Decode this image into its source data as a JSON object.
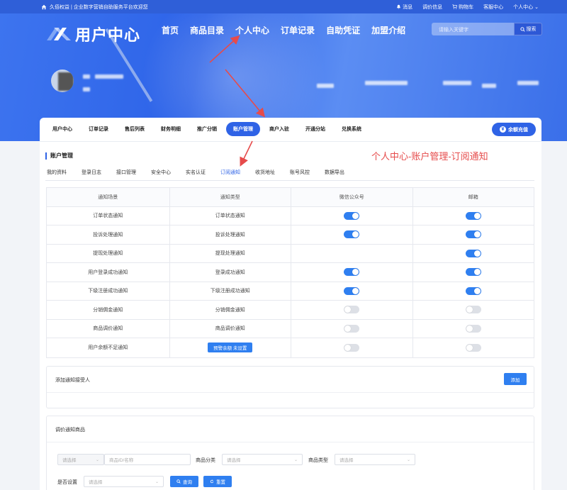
{
  "topbar": {
    "brand_text": "久佰权益 | 企业数字营销自助服务平台欢迎您",
    "links": [
      "消息",
      "调价信息",
      "购物车",
      "客服中心",
      "个人中心"
    ]
  },
  "header": {
    "logo_text": "用户中心",
    "nav": [
      "首页",
      "商品目录",
      "个人中心",
      "订单记录",
      "自助凭证",
      "加盟介绍"
    ],
    "search_placeholder": "请输入关键字",
    "search_button": "搜索"
  },
  "account_tabs": [
    "用户中心",
    "订单记录",
    "售后列表",
    "财务明细",
    "推广分销",
    "账户管理",
    "商户入驻",
    "开通分站",
    "兑换系统"
  ],
  "active_account_tab": "账户管理",
  "recharge_button": "余额充值",
  "section_title": "账户管理",
  "annotation": "个人中心-账户管理-订阅通知",
  "sub_tabs": [
    "我的资料",
    "登录日志",
    "接口管理",
    "安全中心",
    "实名认证",
    "订阅通知",
    "收货地址",
    "账号风控",
    "数据导出"
  ],
  "active_sub_tab": "订阅通知",
  "table": {
    "headers": [
      "通知场景",
      "通知类型",
      "微信公众号",
      "邮箱"
    ],
    "rows": [
      {
        "scene": "订单状态通知",
        "type": "订单状态通知",
        "wechat": "on",
        "email": "on"
      },
      {
        "scene": "投诉处理通知",
        "type": "投诉处理通知",
        "wechat": "on",
        "email": "on"
      },
      {
        "scene": "提现处理通知",
        "type": "提现处理通知",
        "wechat": "none",
        "email": "on"
      },
      {
        "scene": "用户登录成功通知",
        "type": "登录成功通知",
        "wechat": "on",
        "email": "on"
      },
      {
        "scene": "下级注册成功通知",
        "type": "下级注册成功通知",
        "wechat": "on",
        "email": "on"
      },
      {
        "scene": "分销佣金通知",
        "type": "分销佣金通知",
        "wechat": "off",
        "email": "off"
      },
      {
        "scene": "商品调价通知",
        "type": "商品调价通知",
        "wechat": "off",
        "email": "off"
      },
      {
        "scene": "用户余额不足通知",
        "type": "预警余额 未设置",
        "type_is_button": true,
        "wechat": "off",
        "email": "off"
      }
    ]
  },
  "recipients": {
    "label": "添加通知接受人",
    "add_button": "添加"
  },
  "price_goods": {
    "label": "调价通知商品",
    "select_placeholder": "请选择",
    "goods_input_placeholder": "商品ID/名称",
    "category_label": "商品分类",
    "type_label": "商品类型",
    "is_set_label": "是否设置",
    "query_button": "查询",
    "reset_button": "重置"
  },
  "colors": {
    "primary": "#2f63e6",
    "toggle_on": "#2f7ff0",
    "annotation": "#e64b4b"
  }
}
